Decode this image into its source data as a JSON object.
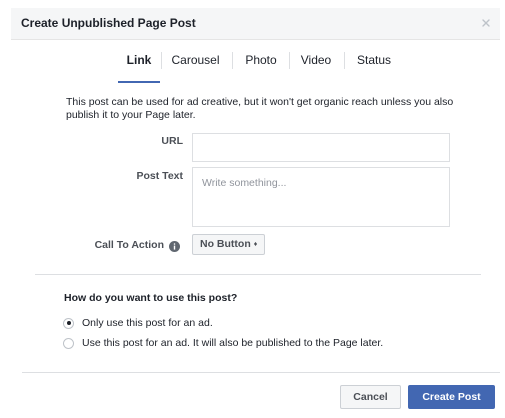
{
  "dialog": {
    "title": "Create Unpublished Page Post",
    "close_icon": "close-icon"
  },
  "tabs": [
    {
      "label": "Link",
      "active": true
    },
    {
      "label": "Carousel",
      "active": false
    },
    {
      "label": "Photo",
      "active": false
    },
    {
      "label": "Video",
      "active": false
    },
    {
      "label": "Status",
      "active": false
    }
  ],
  "notice": "This post can be used for ad creative, but it won't get organic reach unless you also publish it to your Page later.",
  "form": {
    "url_label": "URL",
    "url_value": "",
    "post_text_label": "Post Text",
    "post_text_placeholder": "Write something...",
    "post_text_value": "",
    "cta_label": "Call To Action",
    "cta_info_icon": "info-icon",
    "cta_value": "No Button",
    "cta_caret": "♦"
  },
  "usage": {
    "question": "How do you want to use this post?",
    "options": [
      {
        "label": "Only use this post for an ad.",
        "selected": true
      },
      {
        "label": "Use this post for an ad. It will also be published to the Page later.",
        "selected": false
      }
    ]
  },
  "footer": {
    "cancel_label": "Cancel",
    "create_label": "Create Post"
  },
  "colors": {
    "accent": "#4267b2",
    "header_bg": "#f5f6f7",
    "border": "#dddfe2"
  }
}
